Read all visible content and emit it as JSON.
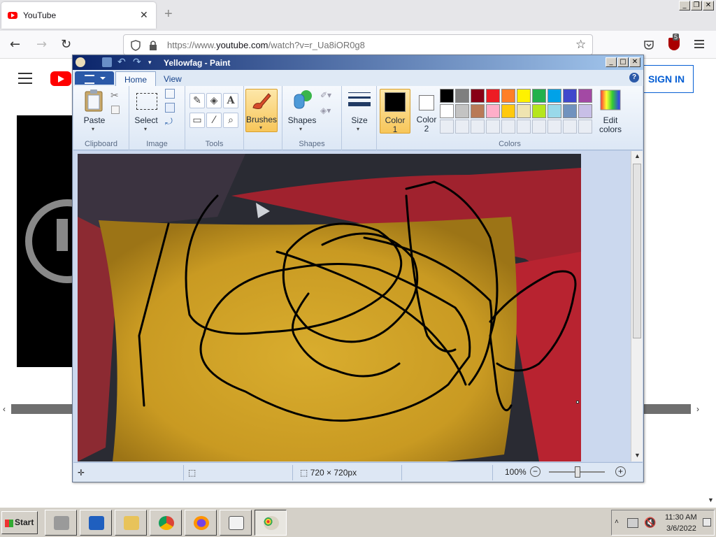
{
  "browser": {
    "tab_title": "YouTube",
    "url_prefix": "https://www.",
    "url_domain": "youtube.com",
    "url_path": "/watch?v=r_Ua8iOR0g8",
    "extension_badge": "5"
  },
  "youtube": {
    "sign_in": "SIGN IN"
  },
  "paint": {
    "window_title": "Yellowfag - Paint",
    "tabs": [
      "Home",
      "View"
    ],
    "groups": {
      "clipboard": "Clipboard",
      "image": "Image",
      "tools": "Tools",
      "shapes": "Shapes",
      "colors": "Colors"
    },
    "buttons": {
      "paste": "Paste",
      "select": "Select",
      "brushes": "Brushes",
      "shapes": "Shapes",
      "size": "Size",
      "color1_a": "Color",
      "color1_b": "1",
      "color2_a": "Color",
      "color2_b": "2",
      "edit_colors_a": "Edit",
      "edit_colors_b": "colors"
    },
    "palette": [
      "#000000",
      "#7f7f7f",
      "#880015",
      "#ed1c24",
      "#ff7f27",
      "#fff200",
      "#22b14c",
      "#00a2e8",
      "#3f48cc",
      "#a349a4",
      "#ffffff",
      "#c3c3c3",
      "#b97a57",
      "#ffaec9",
      "#ffc90e",
      "#efe4b0",
      "#b5e61d",
      "#99d9ea",
      "#7092be",
      "#c8bfe7"
    ],
    "color1": "#000000",
    "color2": "#ffffff",
    "status": {
      "dimensions": "720 × 720px",
      "zoom": "100%"
    }
  },
  "taskbar": {
    "start": "Start",
    "time": "11:30 AM",
    "date": "3/6/2022"
  }
}
